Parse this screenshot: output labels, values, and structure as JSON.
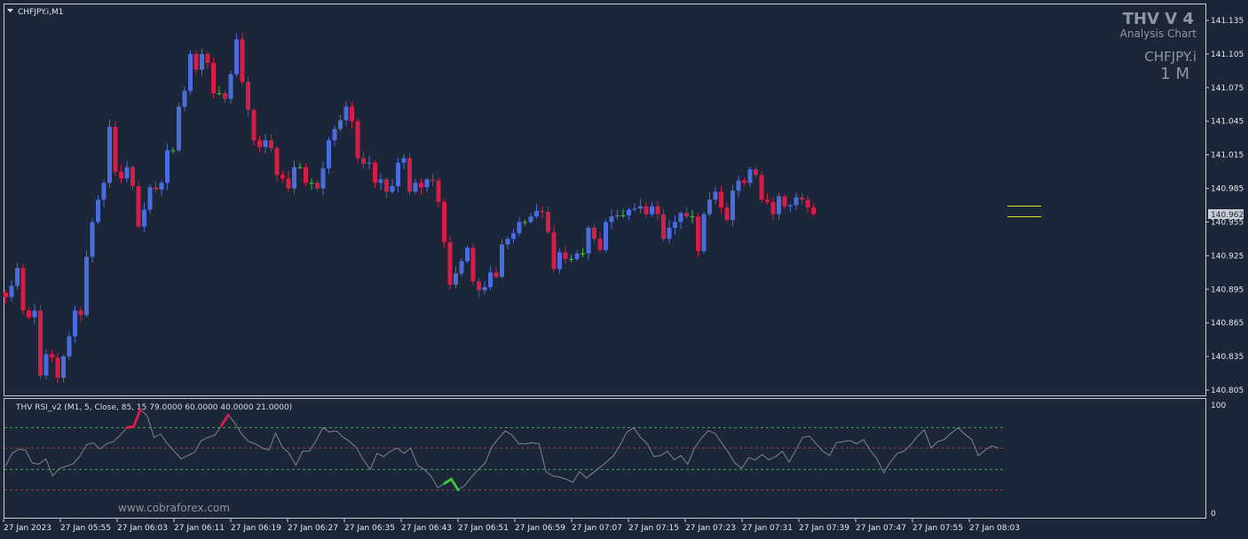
{
  "window": {
    "symbol_title": "CHFJPY.i,M1"
  },
  "brand": {
    "name": "THV V 4",
    "subtitle": "Analysis Chart",
    "symbol": "CHFJPY.i",
    "timeframe": "1 M"
  },
  "current_price": "140.962",
  "indicator": {
    "label": "THV RSI_v2  (M1,  5,  Close,  85,  15 79.0000 60.0000 40.0000 21.0000)",
    "levels": [
      79,
      60,
      40,
      21
    ],
    "scale_labels": [
      "100",
      "0"
    ]
  },
  "watermark": "www.cobraforex.com",
  "colors": {
    "background": "#1b2638",
    "bull": "#4a6cdc",
    "bear": "#d51d47",
    "doji": "#3bc43b",
    "grid_border": "#c8ccd2",
    "level_green": "#2eb82e",
    "level_red": "#c32a2a",
    "rsi_line": "#7b8594",
    "price_line": "#e8e32a"
  },
  "chart_data": {
    "type": "candlestick",
    "price_axis_ticks": [
      "141.135",
      "141.105",
      "141.075",
      "141.045",
      "141.015",
      "140.985",
      "140.955",
      "140.925",
      "140.895",
      "140.865",
      "140.835",
      "140.805"
    ],
    "time_axis_labels": [
      "27 Jan 2023",
      "27 Jan 05:55",
      "27 Jan 06:03",
      "27 Jan 06:11",
      "27 Jan 06:19",
      "27 Jan 06:27",
      "27 Jan 06:35",
      "27 Jan 06:43",
      "27 Jan 06:51",
      "27 Jan 06:59",
      "27 Jan 07:07",
      "27 Jan 07:15",
      "27 Jan 07:23",
      "27 Jan 07:31",
      "27 Jan 07:39",
      "27 Jan 07:47",
      "27 Jan 07:55",
      "27 Jan 08:03"
    ],
    "ylim": [
      140.799,
      141.142
    ],
    "closes": [
      140.888,
      140.898,
      140.914,
      140.876,
      140.87,
      140.876,
      140.818,
      140.837,
      140.834,
      140.816,
      140.835,
      140.853,
      140.876,
      140.872,
      140.924,
      140.955,
      140.975,
      140.99,
      141.04,
      141.0,
      140.994,
      141.004,
      140.987,
      140.951,
      140.966,
      140.986,
      140.984,
      140.99,
      141.019,
      141.019,
      141.058,
      141.072,
      141.105,
      141.091,
      141.105,
      141.097,
      141.07,
      141.07,
      141.065,
      141.087,
      141.118,
      141.08,
      141.055,
      141.028,
      141.022,
      141.028,
      141.021,
      140.997,
      140.994,
      140.985,
      141.004,
      141.004,
      140.99,
      140.99,
      140.985,
      141.003,
      141.028,
      141.038,
      141.046,
      141.058,
      141.045,
      141.012,
      141.007,
      141.008,
      140.99,
      140.993,
      140.982,
      140.987,
      141.008,
      141.012,
      140.982,
      140.99,
      140.986,
      140.993,
      140.992,
      140.973,
      140.937,
      140.899,
      140.909,
      140.92,
      140.932,
      140.902,
      140.894,
      140.897,
      140.91,
      140.906,
      140.935,
      140.94,
      140.945,
      140.955,
      140.955,
      140.96,
      140.965,
      140.964,
      140.946,
      140.913,
      140.928,
      140.922,
      140.922,
      140.927,
      140.927,
      140.95,
      140.94,
      140.93,
      140.955,
      140.96,
      140.961,
      140.961,
      140.966,
      140.967,
      140.969,
      140.962,
      140.969,
      140.962,
      140.94,
      140.95,
      140.955,
      140.963,
      140.96,
      140.96,
      140.929,
      140.962,
      140.975,
      140.982,
      140.968,
      140.957,
      140.983,
      140.992,
      140.99,
      141.002,
      140.997,
      140.975,
      140.973,
      140.962,
      140.978,
      140.969,
      140.97,
      140.977,
      140.975,
      140.968,
      140.962
    ],
    "rsi_values": [
      43,
      55,
      59,
      58,
      46,
      45,
      50,
      34,
      41,
      43,
      45,
      52,
      63,
      65,
      59,
      64,
      66,
      72,
      79,
      80,
      96,
      90,
      70,
      73,
      64,
      57,
      50,
      53,
      56,
      67,
      70,
      72,
      81,
      91,
      83,
      73,
      66,
      64,
      60,
      58,
      74,
      61,
      55,
      44,
      57,
      57,
      67,
      79,
      75,
      76,
      70,
      66,
      60,
      49,
      40,
      55,
      52,
      57,
      60,
      55,
      60,
      44,
      40,
      34,
      23,
      27,
      31,
      21,
      25,
      33,
      40,
      46,
      61,
      69,
      76,
      72,
      64,
      64,
      65,
      64,
      38,
      34,
      33,
      31,
      28,
      38,
      32,
      37,
      42,
      47,
      53,
      63,
      75,
      79,
      70,
      64,
      52,
      53,
      57,
      49,
      53,
      45,
      60,
      69,
      76,
      74,
      65,
      56,
      46,
      41,
      51,
      49,
      54,
      49,
      52,
      57,
      47,
      58,
      70,
      71,
      64,
      57,
      53,
      65,
      66,
      67,
      64,
      68,
      58,
      50,
      37,
      47,
      55,
      57,
      63,
      71,
      77,
      60,
      66,
      68,
      74,
      79,
      73,
      68,
      53,
      58,
      62,
      60
    ]
  }
}
